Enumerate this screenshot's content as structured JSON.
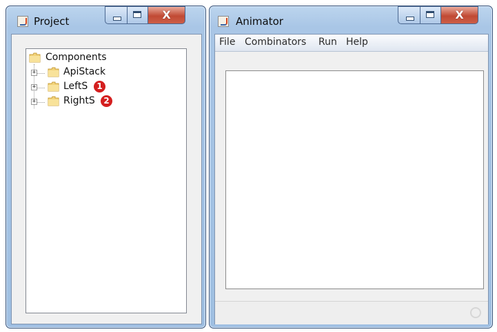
{
  "project_window": {
    "title": "Project",
    "icon": "java-cup-icon",
    "controls": {
      "close_label": "X"
    },
    "tree": {
      "root": {
        "label": "Components",
        "icon": "folder-icon"
      },
      "children": [
        {
          "label": "ApiStack",
          "icon": "folder-icon",
          "expander": "+"
        },
        {
          "label": "LeftS",
          "icon": "folder-icon",
          "expander": "+",
          "badge": "1"
        },
        {
          "label": "RightS",
          "icon": "folder-icon",
          "expander": "+",
          "badge": "2"
        }
      ]
    }
  },
  "animator_window": {
    "title": "Animator",
    "icon": "java-cup-icon",
    "controls": {
      "close_label": "X"
    },
    "menu": [
      "File",
      "Combinators",
      "Run",
      "Help"
    ]
  },
  "colors": {
    "badge": "#d41f1f",
    "titlebar": "#a9c6e6",
    "close_button": "#c14a34"
  }
}
